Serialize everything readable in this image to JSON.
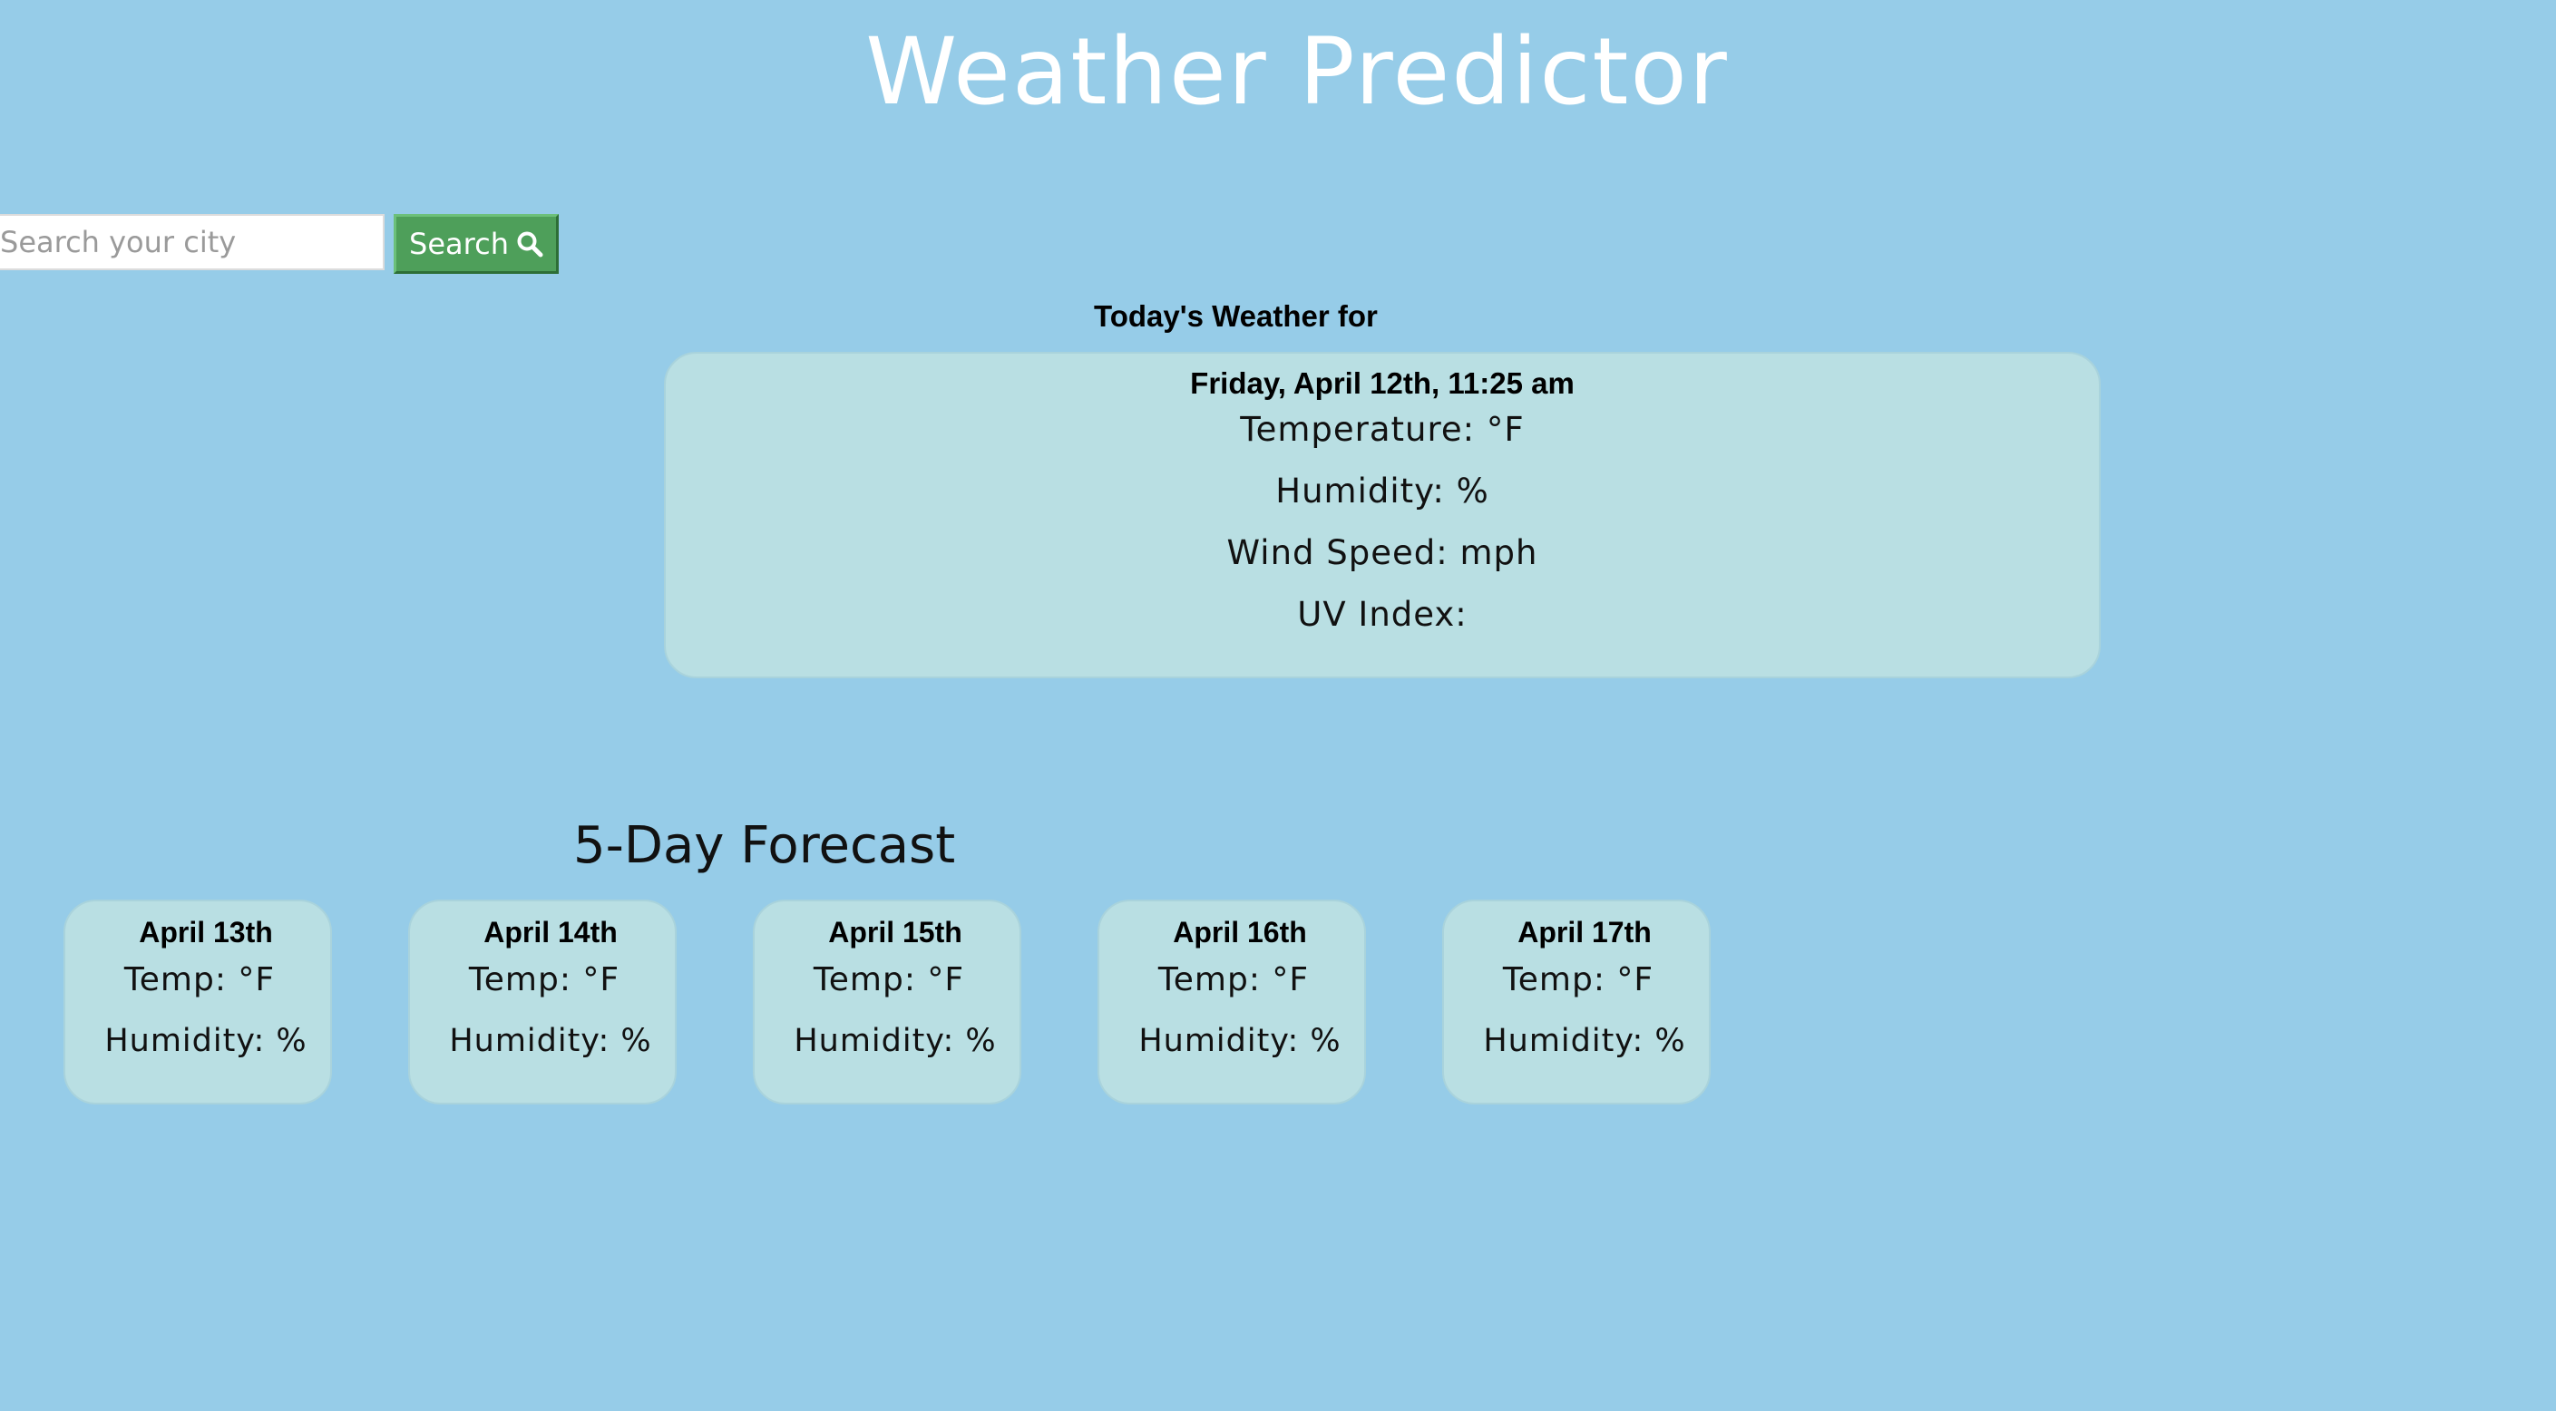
{
  "header": {
    "title": "Weather Predictor"
  },
  "search": {
    "placeholder": "Search your city",
    "value": "",
    "button_label": "Search",
    "button_icon": "search-icon"
  },
  "today": {
    "heading": "Today's Weather for",
    "date": "Friday, April 12th, 11:25 am",
    "temperature": "Temperature: °F",
    "humidity": "Humidity: %",
    "wind_speed": "Wind Speed: mph",
    "uv_index": "UV Index:"
  },
  "forecast": {
    "heading": "5-Day Forecast",
    "days": [
      {
        "date": "April 13th",
        "temp": "Temp: °F",
        "humidity": "Humidity: %"
      },
      {
        "date": "April 14th",
        "temp": "Temp: °F",
        "humidity": "Humidity: %"
      },
      {
        "date": "April 15th",
        "temp": "Temp: °F",
        "humidity": "Humidity: %"
      },
      {
        "date": "April 16th",
        "temp": "Temp: °F",
        "humidity": "Humidity: %"
      },
      {
        "date": "April 17th",
        "temp": "Temp: °F",
        "humidity": "Humidity: %"
      }
    ]
  },
  "colors": {
    "background": "#96cce8",
    "card": "#b9dfe3",
    "search_button": "#4e9f5a",
    "title": "#ffffff"
  }
}
